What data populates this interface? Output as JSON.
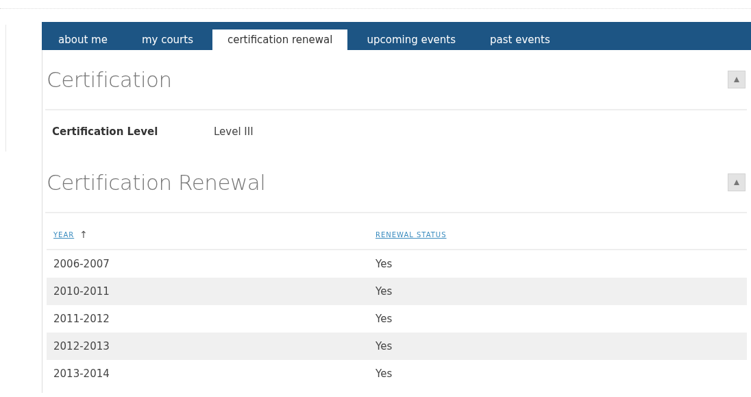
{
  "tabs": [
    {
      "label": "about me",
      "selected": false
    },
    {
      "label": "my courts",
      "selected": false
    },
    {
      "label": "certification renewal",
      "selected": true
    },
    {
      "label": "upcoming events",
      "selected": false
    },
    {
      "label": "past events",
      "selected": false
    }
  ],
  "certification": {
    "title": "Certification",
    "expanded": true,
    "fields": [
      {
        "label": "Certification Level",
        "value": "Level III"
      }
    ]
  },
  "renewal": {
    "title": "Certification Renewal",
    "expanded": true,
    "table": {
      "columns": [
        {
          "label": "YEAR",
          "sort": "↑"
        },
        {
          "label": "RENEWAL STATUS"
        }
      ],
      "rows": [
        [
          "2006-2007",
          "Yes"
        ],
        [
          "2010-2011",
          "Yes"
        ],
        [
          "2011-2012",
          "Yes"
        ],
        [
          "2012-2013",
          "Yes"
        ],
        [
          "2013-2014",
          "Yes"
        ]
      ]
    }
  }
}
